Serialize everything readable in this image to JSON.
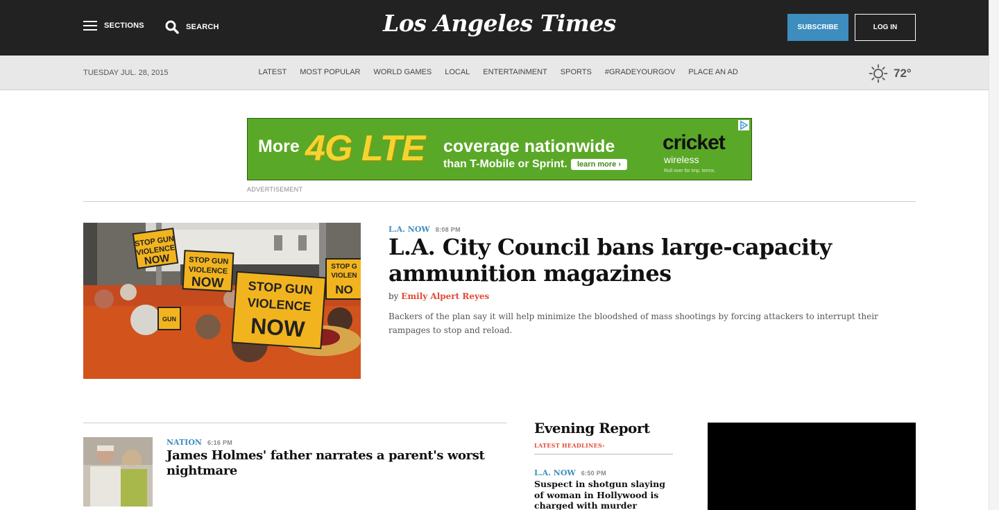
{
  "header": {
    "sections_label": "SECTIONS",
    "search_label": "SEARCH",
    "logo_text": "Los Angeles Times",
    "subscribe_label": "SUBSCRIBE",
    "login_label": "LOG IN"
  },
  "navbar": {
    "date": "TUESDAY JUL. 28, 2015",
    "links": [
      "LATEST",
      "MOST POPULAR",
      "WORLD GAMES",
      "LOCAL",
      "ENTERTAINMENT",
      "SPORTS",
      "#GRADEYOURGOV",
      "PLACE AN AD"
    ],
    "weather_icon": "sun-icon",
    "temperature": "72°"
  },
  "ad": {
    "more": "More",
    "highlight": "4G LTE",
    "coverage": "coverage nationwide",
    "than": "than T-Mobile or Sprint.",
    "learn_more": "learn more ›",
    "brand": "cricket",
    "brand_sub": "wireless",
    "fine_print": "Roll over for imp. terms.",
    "label": "ADVERTISEMENT",
    "colors": {
      "background": "#5aa827",
      "highlight": "#f5d430"
    }
  },
  "lead_story": {
    "kicker": "L.A. NOW",
    "time": "8:08 PM",
    "headline": "L.A. City Council bans large-capacity ammunition magazines",
    "by": "by",
    "author": "Emily Alpert Reyes",
    "description": "Backers of the plan say it will help minimize the bloodshed of mass shootings by forcing attackers to interrupt their rampages to stop and reload.",
    "image_signs": [
      "STOP GUN VIOLENCE NOW",
      "STOP GUN VIOLENCE NOW",
      "STOP GUN VIOLENCE NOW",
      "STOP G VIOLEN",
      "GUN"
    ]
  },
  "secondary_story": {
    "kicker": "NATION",
    "time": "6:16 PM",
    "headline": "James Holmes' father narrates a parent's worst nightmare"
  },
  "evening_report": {
    "title": "Evening Report",
    "link": "LATEST HEADLINES",
    "kicker": "L.A. NOW",
    "time": "6:50 PM",
    "headline": "Suspect in shotgun slaying of woman in Hollywood is charged with murder"
  },
  "colors": {
    "header_bg": "#222222",
    "accent_blue": "#3e8dbf",
    "byline_red": "#e14b37",
    "navbar_bg": "#e8e8e8"
  }
}
